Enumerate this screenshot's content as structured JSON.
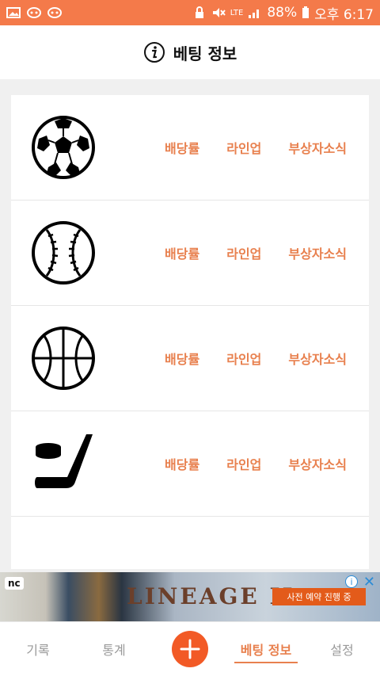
{
  "status_bar": {
    "battery": "88%",
    "time": "오후 6:17",
    "network": "LTE"
  },
  "header": {
    "title": "베팅 정보",
    "icon": "info-icon"
  },
  "sports": [
    {
      "icon": "soccer-ball-icon",
      "links": [
        "배당률",
        "라인업",
        "부상자소식"
      ]
    },
    {
      "icon": "baseball-icon",
      "links": [
        "배당률",
        "라인업",
        "부상자소식"
      ]
    },
    {
      "icon": "basketball-icon",
      "links": [
        "배당률",
        "라인업",
        "부상자소식"
      ]
    },
    {
      "icon": "hockey-icon",
      "links": [
        "배당률",
        "라인업",
        "부상자소식"
      ]
    }
  ],
  "ad": {
    "brand": "nc",
    "title": "LINEAGE II",
    "cta": "사전 예약 진행 중"
  },
  "tabs": [
    {
      "label": "기록",
      "active": false
    },
    {
      "label": "통계",
      "active": false
    },
    {
      "label": "+",
      "fab": true
    },
    {
      "label": "베팅 정보",
      "active": true
    },
    {
      "label": "설정",
      "active": false
    }
  ],
  "colors": {
    "accent": "#e8804e",
    "status_bar": "#f47a4a",
    "fab": "#f25a26"
  }
}
